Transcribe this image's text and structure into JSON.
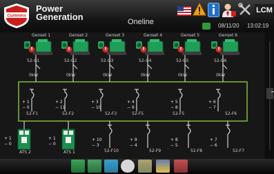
{
  "header": {
    "brand_line1": "Power",
    "brand_line2": "Generation",
    "logo_text": "Cummins",
    "title": "Oneline",
    "lcm_label": "LCM",
    "date": "08/11/20",
    "time": "13:02:19",
    "icons": [
      "us-flag-icon",
      "warning-icon",
      "info-icon",
      "user-icon",
      "tools-icon",
      "printer-icon"
    ]
  },
  "gensets": [
    {
      "name": "Genset 1",
      "breaker": "52-G1",
      "power": "0kW"
    },
    {
      "name": "Genset 2",
      "breaker": "52-G2",
      "power": "0kW"
    },
    {
      "name": "Genset 3",
      "breaker": "52-G3",
      "power": "0kW"
    },
    {
      "name": "Genset 4",
      "breaker": "52-G4",
      "power": "0kW"
    },
    {
      "name": "Genset 5",
      "breaker": "52-G5",
      "power": "0kW"
    },
    {
      "name": "Genset 6",
      "breaker": "52-G6",
      "power": "0kW"
    }
  ],
  "upper_feeders": [
    {
      "breaker": "52-F1",
      "plus": "1",
      "minus": "0"
    },
    {
      "breaker": "52-F2",
      "plus": "2",
      "minus": "11"
    },
    {
      "breaker": "52-F3",
      "plus": "3",
      "minus": "10"
    },
    {
      "breaker": "52-F5",
      "plus": "4",
      "minus": "9"
    },
    {
      "breaker": "52-F5",
      "plus": "5",
      "minus": "8"
    },
    {
      "breaker": "52-F6",
      "plus": "6",
      "minus": "7"
    }
  ],
  "ats": [
    {
      "name": "ATS 2",
      "plus": "1",
      "minus": "0"
    },
    {
      "name": "ATS 1",
      "plus": "1",
      "minus": "0"
    }
  ],
  "lower_feeders": [
    {
      "breaker": "52-F10",
      "plus": "10",
      "minus": "3"
    },
    {
      "breaker": "52-F9",
      "plus": "9",
      "minus": "4"
    },
    {
      "breaker": "52-F8",
      "plus": "8",
      "minus": "5"
    },
    {
      "breaker": "52-F7",
      "plus": "7",
      "minus": "6"
    }
  ],
  "toolbar": [
    "oneline-view-button",
    "genset-view-button",
    "panel-view-button",
    "settings-button",
    "map-view-button",
    "network-button",
    "documents-button"
  ],
  "colors": {
    "bus": "#7ab13c",
    "genset": "#1f9e58",
    "breaker_open": "#d42e2e",
    "ats": "#1c9050"
  }
}
